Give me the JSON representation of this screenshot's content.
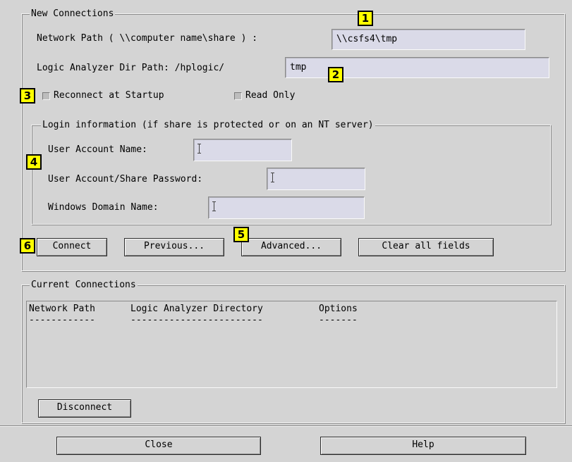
{
  "new_connections": {
    "legend": "New Connections",
    "network_path_label": "Network Path ( \\\\computer name\\share ) :",
    "network_path_value": "\\\\csfs4\\tmp",
    "la_dir_label": "Logic Analyzer Dir Path: /hplogic/",
    "la_dir_value": "tmp",
    "reconnect_label": "Reconnect at Startup",
    "read_only_label": "Read Only",
    "login": {
      "legend": "Login information (if share is protected or on an NT server)",
      "user_account_label": "User Account Name:",
      "password_label": "User Account/Share Password:",
      "domain_label": "Windows Domain Name:"
    },
    "buttons": {
      "connect": "Connect",
      "previous": "Previous...",
      "advanced": "Advanced...",
      "clear": "Clear all fields"
    }
  },
  "current_connections": {
    "legend": "Current Connections",
    "columns": [
      "Network Path",
      "Logic Analyzer Directory",
      "Options"
    ],
    "underlines": [
      "------------",
      "------------------------",
      "-------"
    ],
    "disconnect": "Disconnect"
  },
  "footer": {
    "close": "Close",
    "help": "Help"
  },
  "callouts": [
    "1",
    "2",
    "3",
    "4",
    "5",
    "6"
  ],
  "colors": {
    "background": "#d4d4d4",
    "field": "#dadae8",
    "callout": "#ffff00"
  }
}
